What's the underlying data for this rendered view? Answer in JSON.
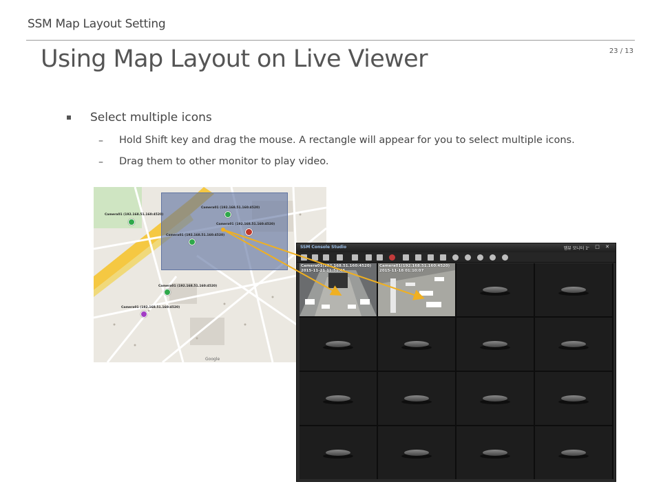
{
  "header": {
    "title": "SSM Map Layout Setting"
  },
  "page_number": "23 / 13",
  "title": "Using Map Layout on Live Viewer",
  "bullet": {
    "text": "Select multiple icons",
    "sub_items": [
      "Hold Shift key and drag the mouse. A rectangle will appear for you to select multiple icons.",
      "Drag them to other monitor to play video."
    ],
    "dash": "–"
  },
  "map": {
    "cameras": [
      {
        "label": "Camera01 (192.168.51.160:4520)",
        "color": "#2fa84a"
      },
      {
        "label": "Camera01 (192.168.51.160:4520)",
        "color": "#2fa84a"
      },
      {
        "label": "Camera01 (192.168.51.160:4520)",
        "color": "#2fa84a"
      },
      {
        "label": "Camera01 (192.168.51.160:4520)",
        "color": "#2fa84a"
      },
      {
        "label": "Camera01 (192.168.51.160:4520)",
        "color": "#c0392b"
      },
      {
        "label": "Camera01 (192.168.51.160:4520)",
        "color": "#2fa84a"
      },
      {
        "label": "Camera01 (192.168.51.160:4520)",
        "color": "#a23dc4"
      }
    ],
    "attribution": "Google"
  },
  "console": {
    "app_title": "SSM Console Studio",
    "layout_name": "맵뷰 모니터 1",
    "window_controls": "– □ ✕",
    "cells": [
      {
        "camera": "Camera01(192.168.51.160:4520)",
        "timestamp": "2015-11-21 11:51:45"
      },
      {
        "camera": "Camera01(192.168.51.160:4520)",
        "timestamp": "2015-11-18 01:10:07"
      }
    ]
  },
  "colors": {
    "selection_rect": "#5f73a0",
    "arrow": "#f0b020",
    "selected_cell": "#3ad63a"
  }
}
